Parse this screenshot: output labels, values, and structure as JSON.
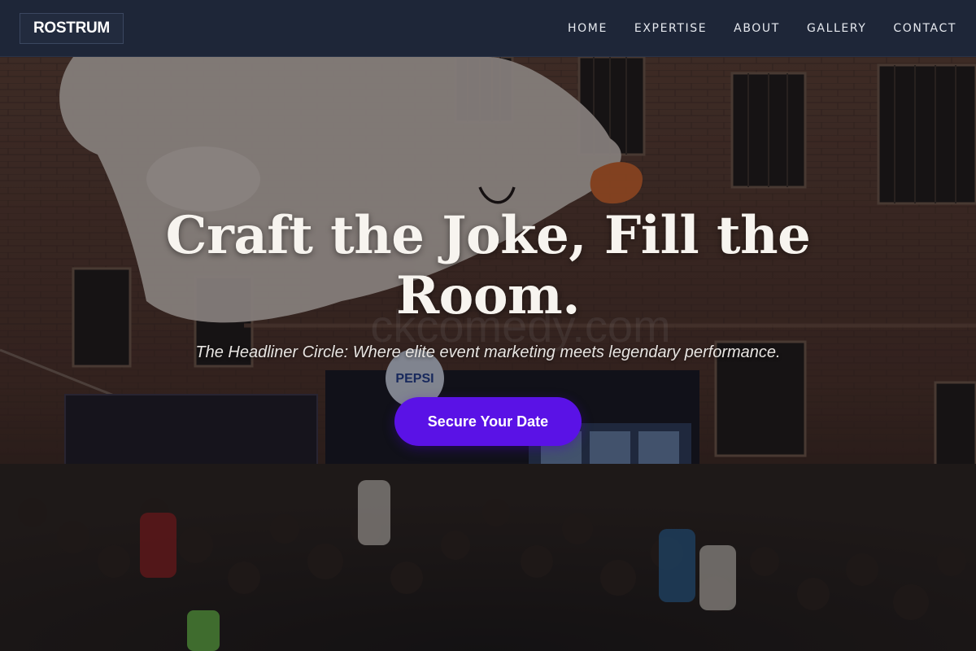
{
  "brand": {
    "logo": "ROSTRUM"
  },
  "nav": {
    "items": [
      {
        "label": "HOME"
      },
      {
        "label": "EXPERTISE"
      },
      {
        "label": "ABOUT"
      },
      {
        "label": "GALLERY"
      },
      {
        "label": "CONTACT"
      }
    ]
  },
  "hero": {
    "headline": "Craft the Joke, Fill the Room.",
    "tagline": "The Headliner Circle: Where elite event marketing meets legendary performance.",
    "cta_label": "Secure Your Date",
    "cta_color": "#5a12e6",
    "overlay_text": "ckcomedy.com",
    "booth_logo_text": "PEPSI"
  },
  "colors": {
    "navbar": "#1e2638",
    "accent": "#5a12e6"
  }
}
